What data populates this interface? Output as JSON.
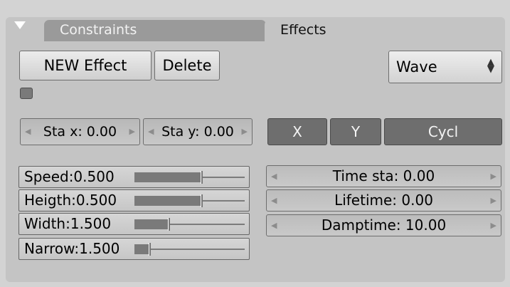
{
  "tabs": {
    "constraints_label": "Constraints",
    "effects_label": "Effects"
  },
  "buttons": {
    "new_effect": "NEW Effect",
    "delete": "Delete"
  },
  "effect_type": {
    "selected": "Wave"
  },
  "wave_settings": {
    "sta_x": "Sta x: 0.00",
    "sta_y": "Sta y: 0.00"
  },
  "axis_toggles": {
    "x": "X",
    "y": "Y",
    "cycl": "Cycl"
  },
  "sliders": [
    {
      "label": "Speed:0.500",
      "fraction": 0.6
    },
    {
      "label": "Heigth:0.500",
      "fraction": 0.6
    },
    {
      "label": "Width:1.500",
      "fraction": 0.3
    },
    {
      "label": "Narrow:1.500",
      "fraction": 0.13
    }
  ],
  "timing": {
    "time_sta": "Time sta: 0.00",
    "lifetime": "Lifetime: 0.00",
    "damptime": "Damptime: 10.00"
  },
  "colors": {
    "panel": "#c4c4c4",
    "active_toggle": "#6e6e6e",
    "background": "#d3d3d3"
  }
}
